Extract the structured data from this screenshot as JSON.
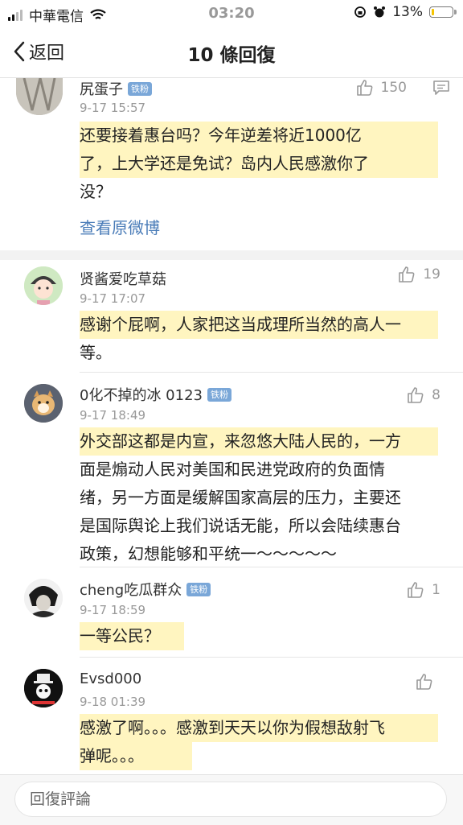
{
  "status_bar": {
    "carrier": "中華電信",
    "time": "03:20",
    "battery": "13%",
    "battery_level": 0.13
  },
  "nav": {
    "back_label": "返回",
    "title": "10 條回復"
  },
  "main_post": {
    "user": "尻蛋子",
    "badge": "铁粉",
    "time": "9-17 15:57",
    "likes": "150",
    "lines": [
      "还要接着惠台吗？今年逆差将近1000亿",
      "了，上大学还是免试？岛内人民感激你了",
      "没？"
    ],
    "link": "查看原微博"
  },
  "comments": [
    {
      "user": "贤酱爱吃草菇",
      "badge": "",
      "time": "9-17 17:07",
      "likes": "19",
      "lines": [
        "感谢个屁啊，人家把这当成理所当然的高人一",
        "等。"
      ]
    },
    {
      "user": "0化不掉的冰 0123",
      "badge": "铁粉",
      "time": "9-17 18:49",
      "likes": "8",
      "lines": [
        "外交部这都是内宣，来忽悠大陆人民的，一方",
        "面是煽动人民对美国和民进党政府的负面情",
        "绪，另一方面是缓解国家高层的压力，主要还",
        "是国际舆论上我们说话无能，所以会陆续惠台",
        "政策，幻想能够和平统一～～～～～"
      ]
    },
    {
      "user": "cheng吃瓜群众",
      "badge": "铁粉",
      "time": "9-17 18:59",
      "likes": "1",
      "lines": [
        "一等公民？"
      ]
    },
    {
      "user": "Evsd000",
      "badge": "",
      "time": "9-18 01:39",
      "likes": "",
      "lines": [
        "感激了啊。。。感激到天天以你为假想敌射飞",
        "弹呢。。。"
      ]
    }
  ],
  "reply": {
    "placeholder": "回復評論"
  }
}
